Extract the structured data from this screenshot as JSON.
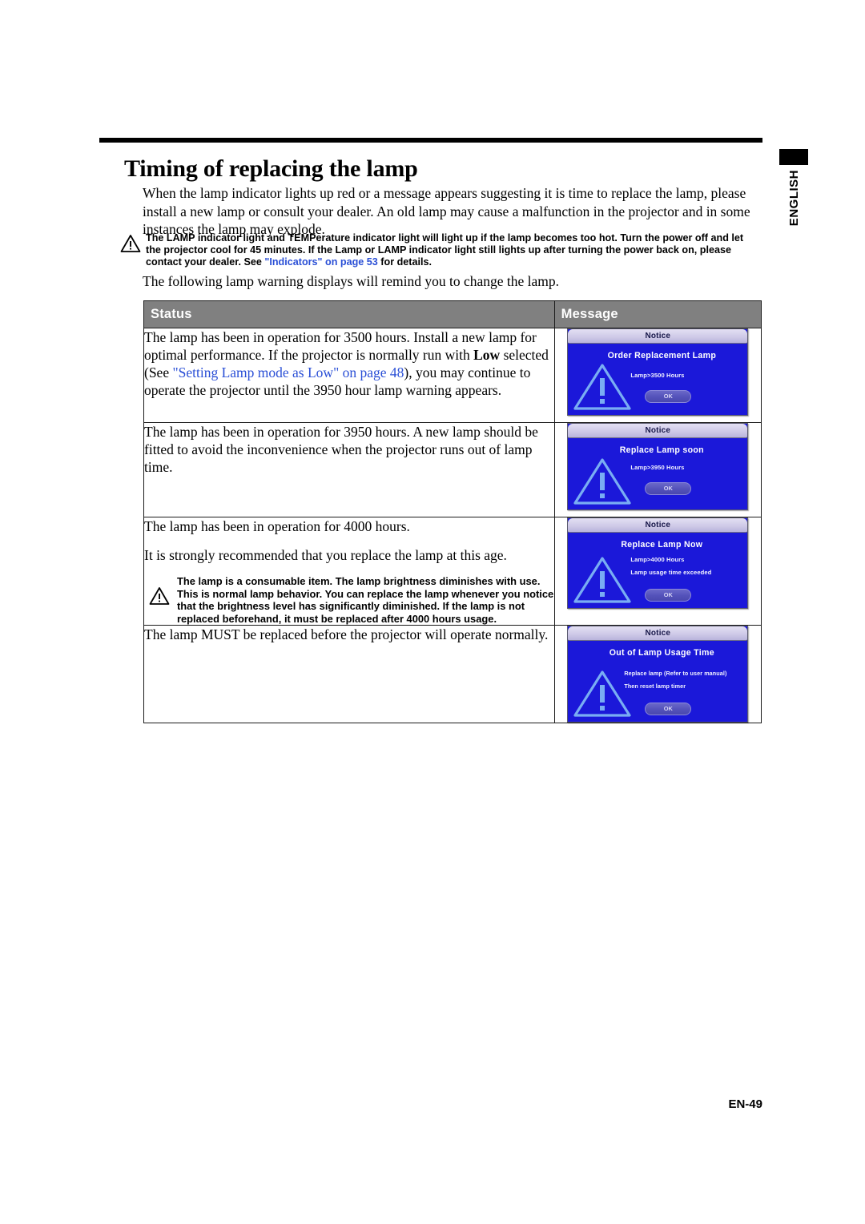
{
  "side_tab": {
    "label": "ENGLISH"
  },
  "heading": "Timing of replacing the lamp",
  "intro": "When the lamp indicator lights up red or a message appears suggesting it is time to replace the lamp, please install a new lamp or consult your dealer. An old lamp may cause a malfunction in the projector and in some instances the lamp may explode.",
  "caution_top": {
    "part1": "The LAMP indicator light and TEMPerature indicator light will light up if the lamp becomes too hot. Turn the power off and let the projector cool for 45 minutes. If the Lamp or LAMP indicator light still lights up after turning the power back on, please contact your dealer. See ",
    "link": "\"Indicators\" on page 53",
    "part2": " for details."
  },
  "lead_in": "The following lamp warning displays will remind you to change the lamp.",
  "table": {
    "headers": {
      "status": "Status",
      "message": "Message"
    },
    "rows": [
      {
        "status_part1": "The lamp has been in operation for 3500 hours. Install a new lamp for optimal performance. If the projector is normally run with ",
        "status_bold": "Low",
        "status_part2": " selected (See ",
        "status_link": "\"Setting Lamp mode as Low\" on page 48",
        "status_part3": "), you may continue to operate the projector until the 3950 hour lamp warning appears.",
        "dialog": {
          "title": "Notice",
          "heading": "Order Replacement Lamp",
          "lines": [
            "Lamp>3500 Hours"
          ],
          "ok": "OK"
        }
      },
      {
        "status_part1": "The lamp has been in operation for 3950 hours. A new lamp should be fitted to avoid the inconvenience when the projector runs out of lamp time.",
        "dialog": {
          "title": "Notice",
          "heading": "Replace Lamp soon",
          "lines": [
            "Lamp>3950 Hours"
          ],
          "ok": "OK"
        }
      },
      {
        "status_line1": "The lamp has been in operation for 4000 hours.",
        "status_line2": "It is strongly recommended that you replace the lamp at this age.",
        "caution": "The lamp is a consumable item. The lamp brightness diminishes with use. This is normal lamp behavior. You can replace the lamp whenever you notice that the brightness level has significantly diminished. If the lamp is not replaced beforehand, it must be replaced after 4000 hours usage.",
        "dialog": {
          "title": "Notice",
          "heading": "Replace Lamp Now",
          "lines": [
            "Lamp>4000 Hours",
            "Lamp usage time exceeded"
          ],
          "ok": "OK"
        }
      },
      {
        "status_part1": "The lamp MUST be replaced before the projector will operate normally.",
        "dialog": {
          "title": "Notice",
          "heading": "Out of Lamp Usage Time",
          "lines": [
            "Replace lamp (Refer to user manual)",
            "Then reset lamp timer"
          ],
          "ok": "OK"
        }
      }
    ]
  },
  "footer": "EN-49",
  "colors": {
    "table_header_bg": "#808080",
    "osd_body_blue": "#1b18d9",
    "osd_title_lavender": "#cfcae8",
    "link_blue": "#2a4fd6",
    "ok_button": "#5553bb"
  }
}
